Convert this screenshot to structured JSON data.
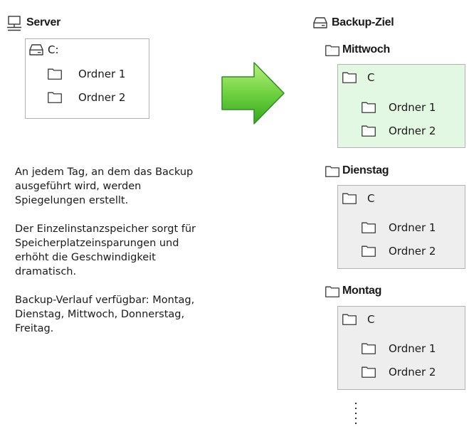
{
  "server": {
    "title": "Server",
    "drive": "C:",
    "folders": [
      "Ordner 1",
      "Ordner 2"
    ]
  },
  "description": [
    "An jedem Tag, an dem das Backup",
    "ausgeführt wird, werden",
    "Spiegelungen erstellt.",
    "Der Einzelinstanzspeicher sorgt für",
    "Speicherplatzeinsparungen und",
    "erhöht die Geschwindigkeit",
    "dramatisch.",
    "Backup-Verlauf verfügbar: Montag,",
    "Dienstag, Mittwoch, Donnerstag,",
    "Freitag."
  ],
  "backup": {
    "title": "Backup-Ziel",
    "days": [
      {
        "name": "Mittwoch",
        "drive": "C",
        "folders": [
          "Ordner 1",
          "Ordner 2"
        ],
        "bg": "#e3f8e3"
      },
      {
        "name": "Dienstag",
        "drive": "C",
        "folders": [
          "Ordner 1",
          "Ordner 2"
        ],
        "bg": "#eeeeee"
      },
      {
        "name": "Montag",
        "drive": "C",
        "folders": [
          "Ordner 1",
          "Ordner 2"
        ],
        "bg": "#eeeeee"
      }
    ]
  },
  "colors": {
    "arrow_top": "#a8ec70",
    "arrow_bottom": "#3cb41e",
    "arrow_stroke": "#2f8f22",
    "border": "#b3b3b3"
  },
  "icons": [
    "computer-icon",
    "hard-drive-icon",
    "folder-icon",
    "arrow-right-icon"
  ]
}
